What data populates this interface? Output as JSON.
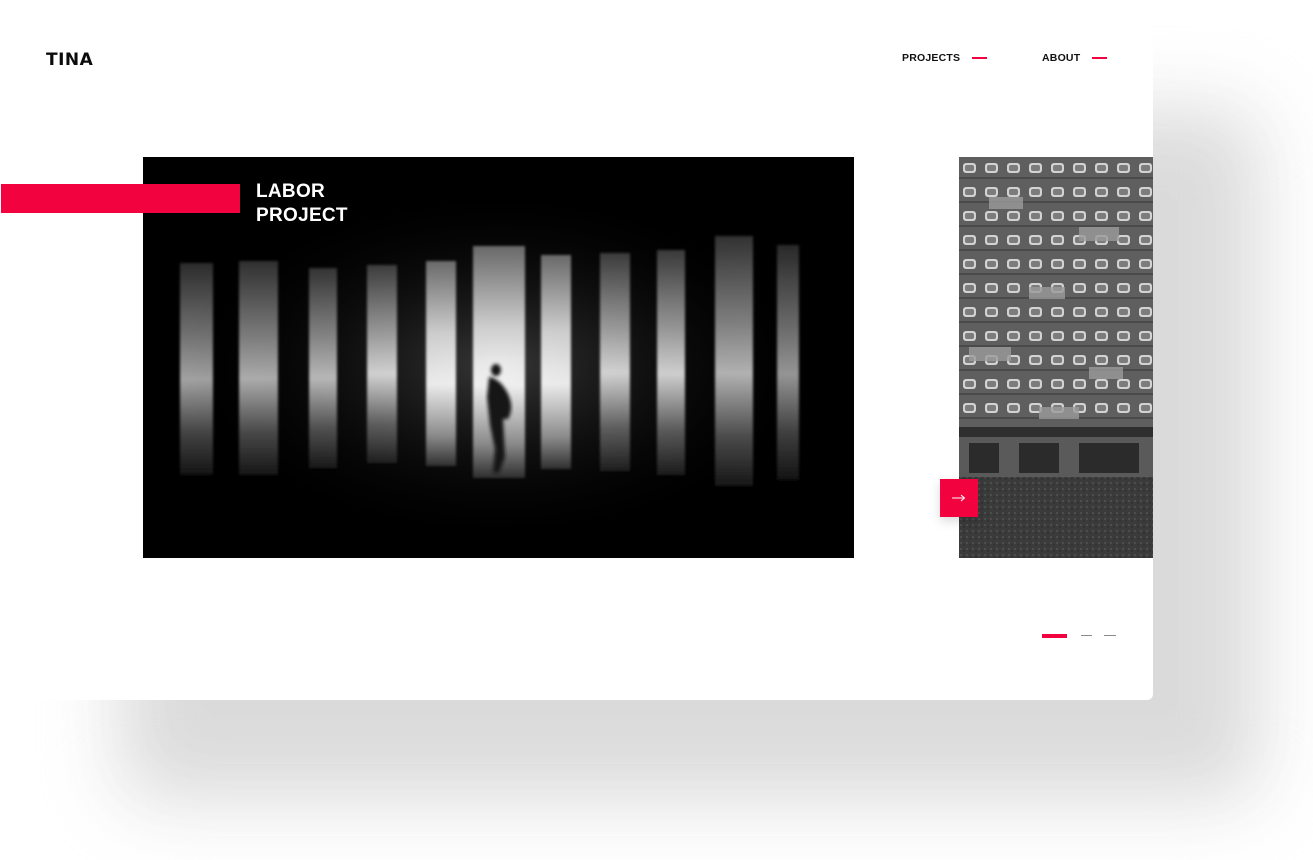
{
  "brand": {
    "logo_text": "TINA",
    "accent_color": "#f2033f"
  },
  "nav": {
    "items": [
      {
        "label": "PROJECTS"
      },
      {
        "label": "ABOUT"
      }
    ]
  },
  "hero": {
    "title_line1": "LABOR",
    "title_line2": "PROJECT",
    "image": "dark-silhouette-windows-photo"
  },
  "side_preview": {
    "image": "apartment-building-photo"
  },
  "controls": {
    "next_icon": "arrow-right-icon"
  },
  "pagination": {
    "total": 3,
    "active_index": 0
  }
}
